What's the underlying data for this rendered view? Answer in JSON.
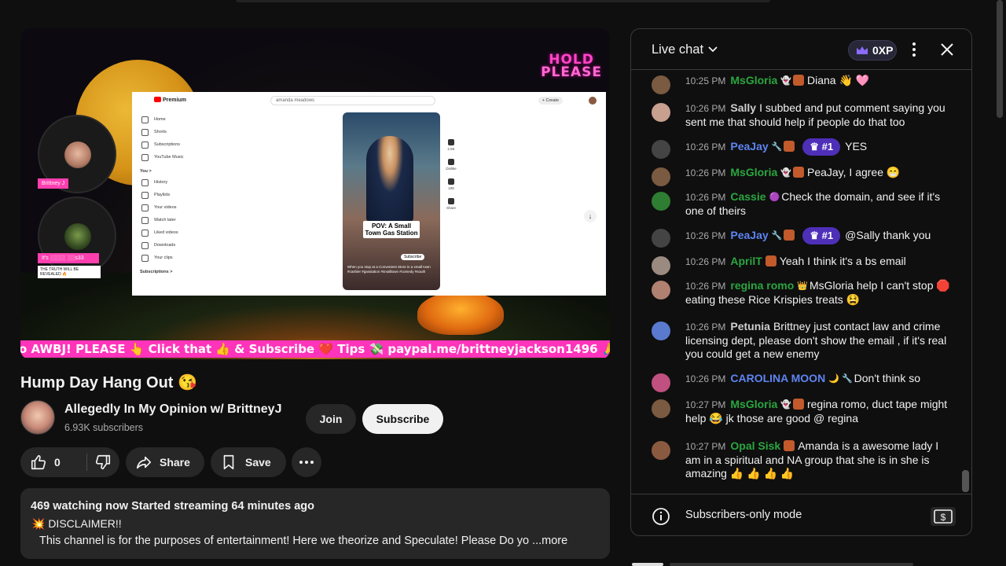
{
  "player": {
    "hold_line1": "HOLD",
    "hold_line2": "PLEASE",
    "tag1": "Brittney J",
    "tag2": "It's ░░░░ ░░s33",
    "tag3": "THE TRUTH WILL BE REVEALED 🔥",
    "ticker": "o AWBJ! PLEASE 👆 Click that 👍 & Subscribe ❤️ Tips 💸 paypal.me/brittneyjackson1496 🙏 cash.ap",
    "screen_share": {
      "logo": "Premium",
      "search_value": "amanda meadows",
      "create": "+ Create",
      "sidebar": [
        "Home",
        "Shorts",
        "Subscriptions",
        "YouTube Music"
      ],
      "you_section": "You  >",
      "you_items": [
        "History",
        "Playlists",
        "Your videos",
        "Watch later",
        "Liked videos",
        "Downloads",
        "Your clips"
      ],
      "subscriptions_section": "Subscriptions  >",
      "short_caption": "POV: A Small Town Gas Station",
      "short_subscribe": "Subscribe",
      "short_text": "When you stop at a Convenient Store in a small town #cashier #gasstation #smalltown #comedy #south",
      "rail": [
        "2.5K",
        "Dislike",
        "108",
        "Share"
      ]
    }
  },
  "video": {
    "title": "Hump Day Hang Out 😘",
    "channel_name": "Allegedly In My Opinion w/ BrittneyJ",
    "subscribers": "6.93K subscribers",
    "join_label": "Join",
    "subscribe_label": "Subscribe",
    "likes": "0",
    "share_label": "Share",
    "save_label": "Save"
  },
  "description": {
    "meta": "469 watching now  Started streaming 64 minutes ago",
    "disclaimer": "💥 DISCLAIMER!!",
    "body": "This channel is for the purposes of entertainment!  Here we theorize and Speculate!  Please Do yo",
    "more": "...more"
  },
  "chat": {
    "title": "Live chat",
    "xp": "0XP",
    "footer": "Subscribers-only mode",
    "messages": [
      {
        "time": "10:25 PM",
        "author": "MsGloria",
        "color": "g",
        "badges": "👻",
        "member": true,
        "rank": "",
        "text": "Diana 👋 🩷"
      },
      {
        "time": "10:26 PM",
        "author": "Sally",
        "color": "gr",
        "badges": "",
        "member": false,
        "rank": "",
        "text": "I subbed and put comment saying you sent me that should help if people do that too"
      },
      {
        "time": "10:26 PM",
        "author": "PeaJay",
        "color": "b",
        "badges": "🔧",
        "member": true,
        "rank": "#1",
        "text": "YES"
      },
      {
        "time": "10:26 PM",
        "author": "MsGloria",
        "color": "g",
        "badges": "👻",
        "member": true,
        "rank": "",
        "text": "PeaJay, I agree 😁"
      },
      {
        "time": "10:26 PM",
        "author": "Cassie",
        "color": "g",
        "badges": "🟣",
        "member": false,
        "rank": "",
        "text": "Check the domain, and see if it's one of theirs"
      },
      {
        "time": "10:26 PM",
        "author": "PeaJay",
        "color": "b",
        "badges": "🔧",
        "member": true,
        "rank": "#1",
        "text": "@Sally thank you"
      },
      {
        "time": "10:26 PM",
        "author": "AprilT",
        "color": "g",
        "badges": "",
        "member": true,
        "rank": "",
        "text": "Yeah I think it's a bs email"
      },
      {
        "time": "10:26 PM",
        "author": "regina romo",
        "color": "g",
        "badges": "👑",
        "member": false,
        "rank": "",
        "text": "MsGloria help I can't stop 🛑 eating these Rice Krispies treats 😫"
      },
      {
        "time": "10:26 PM",
        "author": "Petunia",
        "color": "gr",
        "badges": "",
        "member": false,
        "rank": "",
        "text": "Brittney just contact law and crime licensing dept, please don't show the email , if it's real you could get a new enemy"
      },
      {
        "time": "10:26 PM",
        "author": "CAROLINA MOON",
        "color": "b",
        "badges": "🌙 🔧",
        "member": false,
        "rank": "",
        "text": "Don't think so"
      },
      {
        "time": "10:27 PM",
        "author": "MsGloria",
        "color": "g",
        "badges": "👻",
        "member": true,
        "rank": "",
        "text": "regina romo, duct tape might help 😂 jk those are good @ regina"
      },
      {
        "time": "10:27 PM",
        "author": "Opal Sisk",
        "color": "g",
        "badges": "",
        "member": true,
        "rank": "",
        "text": "Amanda is a awesome lady I am in a spiritual and NA group that she is in she is amazing 👍 👍 👍 👍"
      }
    ]
  }
}
